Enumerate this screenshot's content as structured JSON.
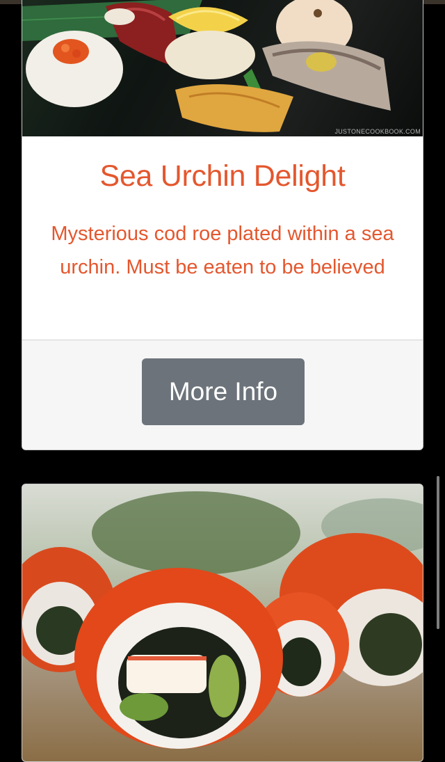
{
  "card1": {
    "image_alt": "Assorted nigiri sushi platter",
    "watermark": "JUSTONECOOKBOOK.COM",
    "title": "Sea Urchin Delight",
    "description": "Mysterious cod roe plated within a sea urchin. Must be eaten to be believed",
    "button_label": "More Info"
  },
  "card2": {
    "image_alt": "California roll sushi topped with orange fish roe"
  },
  "colors": {
    "accent": "#e4572e",
    "button": "#6c737b",
    "background": "#000000",
    "footer": "#f6f6f6"
  }
}
